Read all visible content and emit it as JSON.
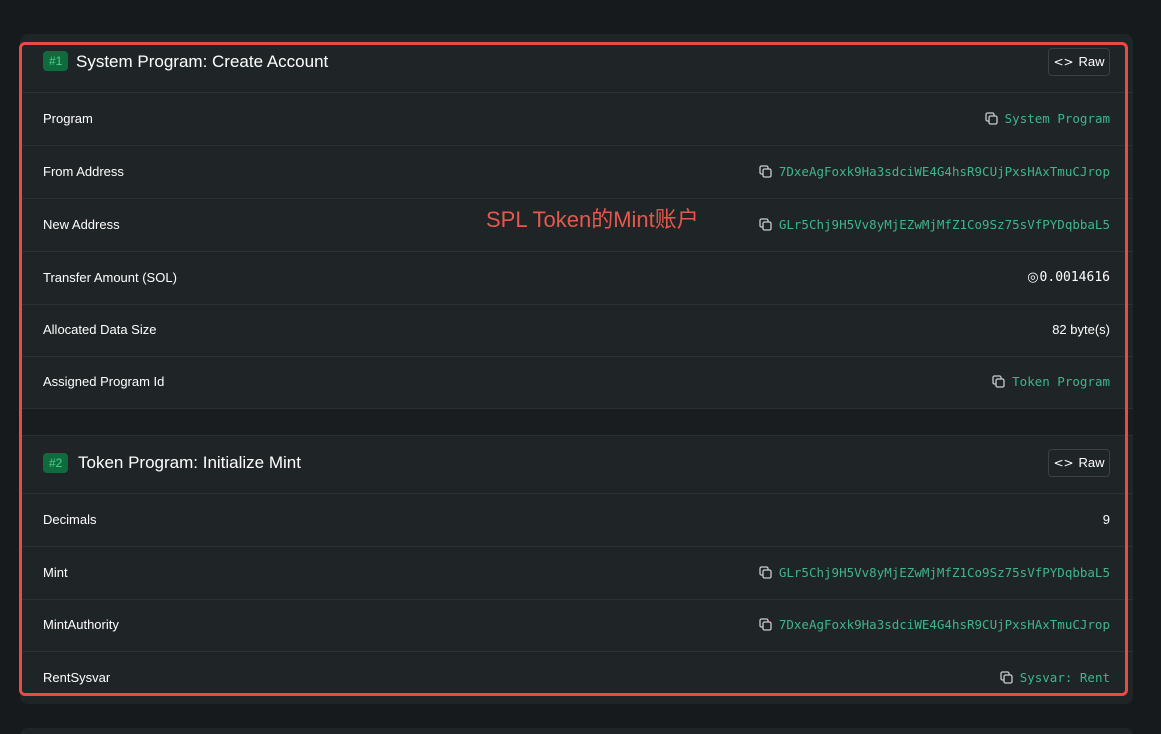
{
  "annotation": "SPL Token的Mint账户",
  "instructions": [
    {
      "badge": "#1",
      "title": "System Program: Create Account",
      "raw_label": "Raw",
      "rows": [
        {
          "label": "Program",
          "value": "System Program",
          "type": "link"
        },
        {
          "label": "From Address",
          "value": "7DxeAgFoxk9Ha3sdciWE4G4hsR9CUjPxsHAxTmuCJrop",
          "type": "link"
        },
        {
          "label": "New Address",
          "value": "GLr5Chj9H5Vv8yMjEZwMjMfZ1Co9Sz75sVfPYDqbbaL5",
          "type": "link"
        },
        {
          "label": "Transfer Amount (SOL)",
          "value": "0.0014616",
          "type": "sol"
        },
        {
          "label": "Allocated Data Size",
          "value": "82 byte(s)",
          "type": "text"
        },
        {
          "label": "Assigned Program Id",
          "value": "Token Program",
          "type": "link"
        }
      ]
    },
    {
      "badge": "#2",
      "title": "Token Program: Initialize Mint",
      "raw_label": "Raw",
      "rows": [
        {
          "label": "Decimals",
          "value": "9",
          "type": "text"
        },
        {
          "label": "Mint",
          "value": "GLr5Chj9H5Vv8yMjEZwMjMfZ1Co9Sz75sVfPYDqbbaL5",
          "type": "link"
        },
        {
          "label": "MintAuthority",
          "value": "7DxeAgFoxk9Ha3sdciWE4G4hsR9CUjPxsHAxTmuCJrop",
          "type": "link"
        },
        {
          "label": "RentSysvar",
          "value": "Sysvar: Rent",
          "type": "link"
        }
      ]
    }
  ],
  "colors": {
    "link": "#3fb58c",
    "badge_bg": "#0f6b3e",
    "badge_text": "#49d08a",
    "annotation": "#e8574d"
  },
  "icons": [
    "copy-icon",
    "code-icon",
    "sol-icon"
  ]
}
